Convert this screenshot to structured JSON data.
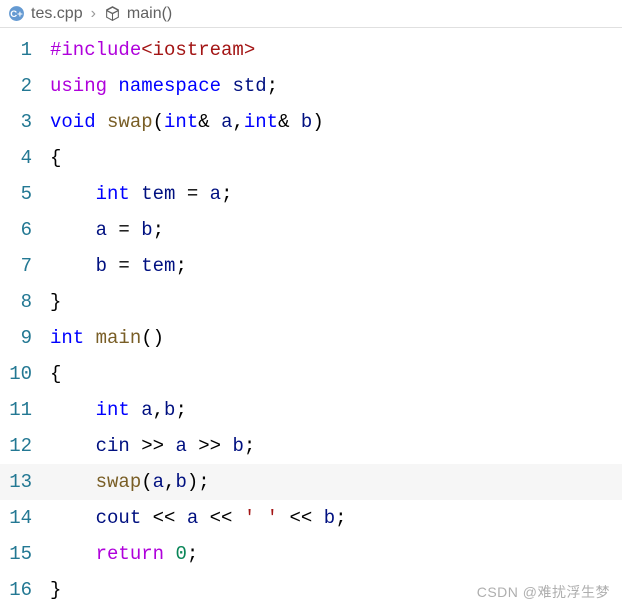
{
  "breadcrumb": {
    "file": "tes.cpp",
    "symbol": "main()"
  },
  "line_numbers": [
    "1",
    "2",
    "3",
    "4",
    "5",
    "6",
    "7",
    "8",
    "9",
    "10",
    "11",
    "12",
    "13",
    "14",
    "15",
    "16"
  ],
  "code": {
    "l1_dir": "#include",
    "l1_inc": "<iostream>",
    "l2_using": "using",
    "l2_ns": "namespace",
    "l2_std": "std",
    "l3_void": "void",
    "l3_swap": "swap",
    "l3_int1": "int",
    "l3_a": "a",
    "l3_int2": "int",
    "l3_b": "b",
    "l4_brace": "{",
    "l5_int": "int",
    "l5_tem": "tem",
    "l5_eq": "=",
    "l5_a": "a",
    "l6_a": "a",
    "l6_eq": "=",
    "l6_b": "b",
    "l7_b": "b",
    "l7_eq": "=",
    "l7_tem": "tem",
    "l8_brace": "}",
    "l9_int": "int",
    "l9_main": "main",
    "l10_brace": "{",
    "l11_int": "int",
    "l11_a": "a",
    "l11_b": "b",
    "l12_cin": "cin",
    "l12_a": "a",
    "l12_b": "b",
    "l13_swap": "swap",
    "l13_a": "a",
    "l13_b": "b",
    "l14_cout": "cout",
    "l14_a": "a",
    "l14_ch": "' '",
    "l14_b": "b",
    "l15_return": "return",
    "l15_zero": "0",
    "l16_brace": "}"
  },
  "watermark": "CSDN @难扰浮生梦"
}
